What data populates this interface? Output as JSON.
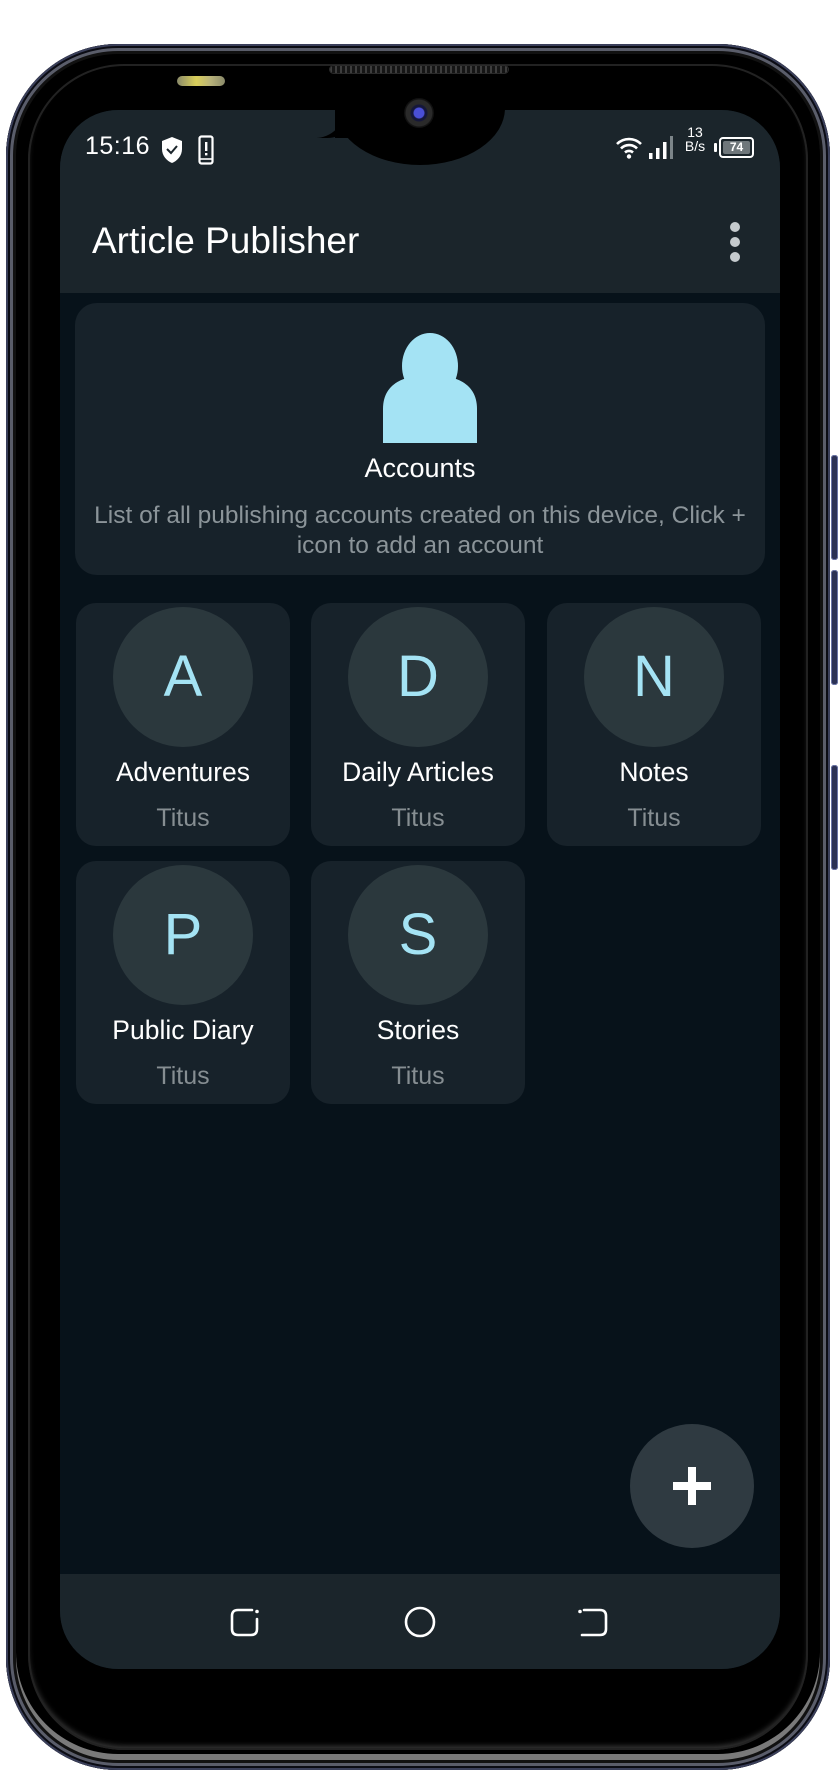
{
  "status_bar": {
    "time": "15:16",
    "left_icons": [
      "shield-check-icon",
      "phone-alert-icon"
    ],
    "right_icons": [
      "wifi-icon",
      "signal-icon",
      "battery-icon"
    ],
    "net_speed_value": "13",
    "net_speed_unit": "B/s",
    "battery_level": "74"
  },
  "app_bar": {
    "title": "Article Publisher",
    "menu_icon": "more-vert-icon"
  },
  "header_card": {
    "icon": "person-icon",
    "title": "Accounts",
    "description": "List of all publishing accounts created on this device, Click + icon to add an account"
  },
  "accounts": [
    {
      "initial": "A",
      "name": "Adventures",
      "owner": "Titus"
    },
    {
      "initial": "D",
      "name": "Daily Articles",
      "owner": "Titus"
    },
    {
      "initial": "N",
      "name": "Notes",
      "owner": "Titus"
    },
    {
      "initial": "P",
      "name": "Public Diary",
      "owner": "Titus"
    },
    {
      "initial": "S",
      "name": "Stories",
      "owner": "Titus"
    }
  ],
  "fab": {
    "icon": "plus-icon"
  },
  "nav_bar": {
    "buttons": [
      "recent-apps-icon",
      "home-icon",
      "back-icon"
    ]
  },
  "colors": {
    "bar_background": "#1b252b",
    "content_background": "#07121a",
    "card_background": "#17222a",
    "avatar_background": "#2b383d",
    "accent": "#a4e3f4",
    "secondary_text": "#8b9499",
    "fab_background": "#2f3a41"
  }
}
